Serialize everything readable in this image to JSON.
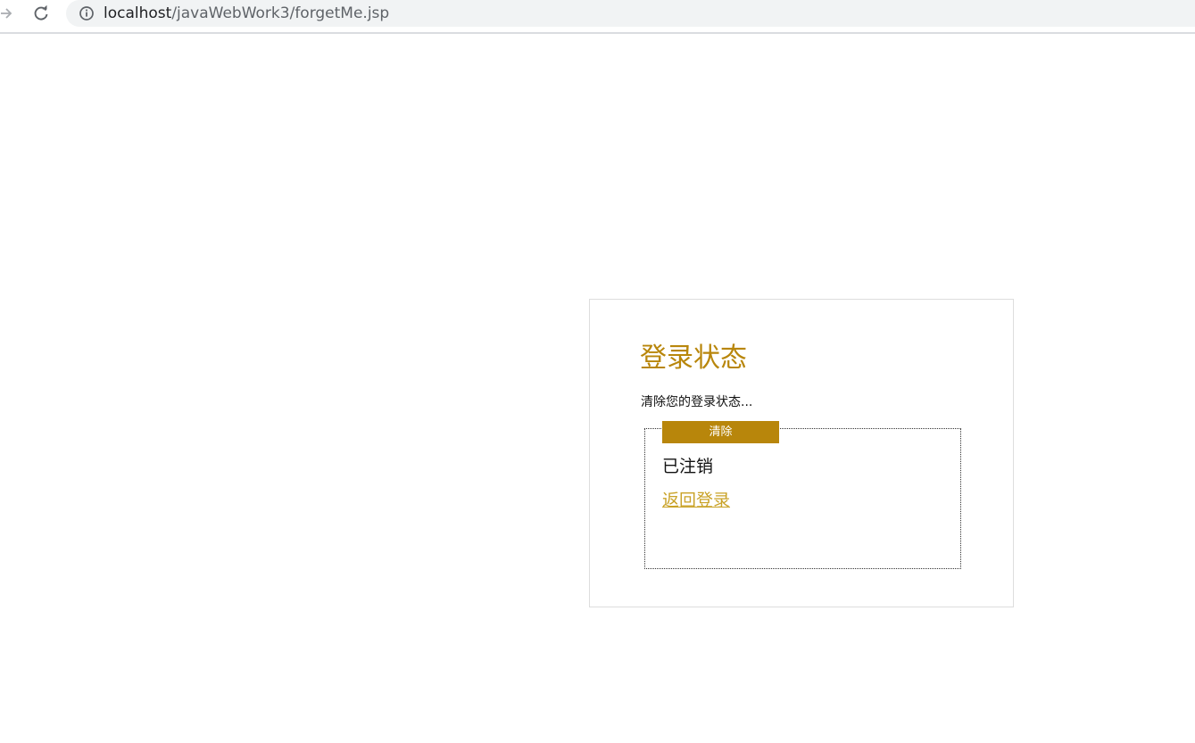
{
  "browser": {
    "url_host": "localhost",
    "url_path": "/javaWebWork3/forgetMe.jsp",
    "icons": {
      "forward": "forward-arrow-icon",
      "reload": "reload-icon",
      "info": "info-icon"
    }
  },
  "page": {
    "title": "登录状态",
    "description": "清除您的登录状态...",
    "clear_button_label": "清除",
    "status_text": "已注销",
    "back_link_label": "返回登录"
  },
  "colors": {
    "accent": "#b8860b",
    "link": "#c9a227",
    "card_border": "#dddddd"
  }
}
